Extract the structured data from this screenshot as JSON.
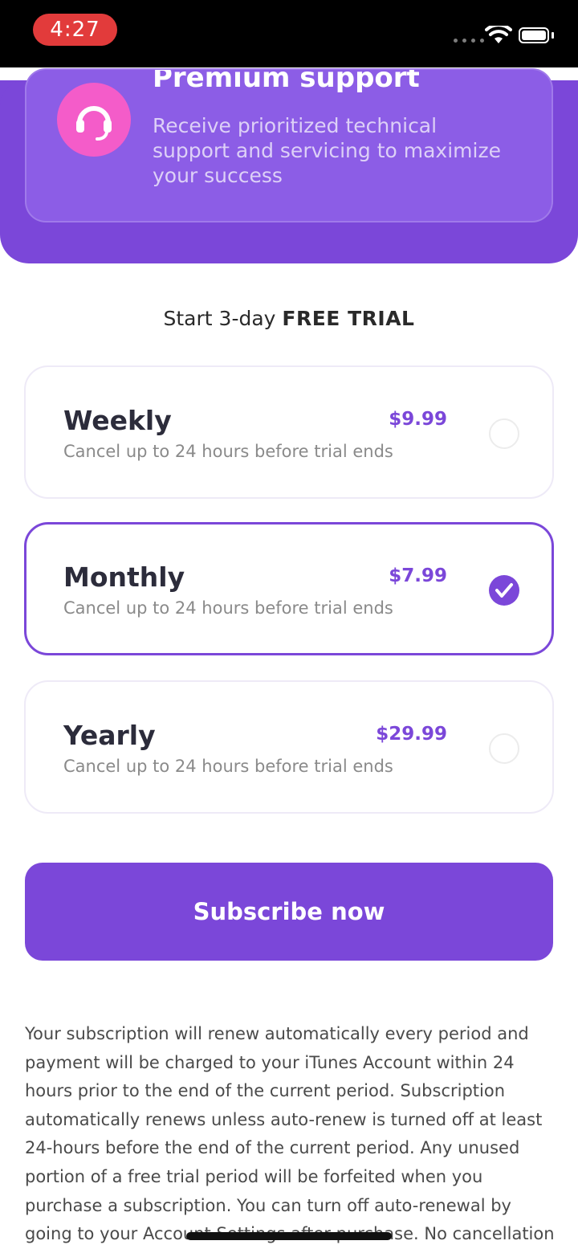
{
  "status_bar": {
    "time": "4:27"
  },
  "feature": {
    "title": "Premium support",
    "description": "Receive prioritized technical support and servicing to maximize your success",
    "icon": "headset-icon",
    "colors": {
      "panel": "#7b47d9",
      "card": "#8c5de6",
      "icon_bg": "#f45cc9"
    }
  },
  "trial": {
    "prefix": "Start 3-day",
    "highlight": "FREE TRIAL"
  },
  "plans": [
    {
      "name": "Weekly",
      "price": "$9.99",
      "note": "Cancel up to 24 hours before trial ends",
      "selected": false
    },
    {
      "name": "Monthly",
      "price": "$7.99",
      "note": "Cancel up to 24 hours before trial ends",
      "selected": true
    },
    {
      "name": "Yearly",
      "price": "$29.99",
      "note": "Cancel up to 24 hours before trial ends",
      "selected": false
    }
  ],
  "cta": {
    "label": "Subscribe now"
  },
  "legal": {
    "text": "Your subscription will renew automatically every period and payment will be charged to your iTunes Account within 24 hours prior to the end of the current period. Subscription automatically renews unless auto-renew is turned off at least 24-hours before the end of the current period. Any unused portion of a free trial period will be forfeited when you purchase a subscription. You can turn off auto-renewal by going to your Account Settings after purchase.  No cancellation"
  },
  "colors": {
    "accent": "#7b47d9",
    "price": "#7b47d9",
    "status_pill": "#e23b3b"
  }
}
